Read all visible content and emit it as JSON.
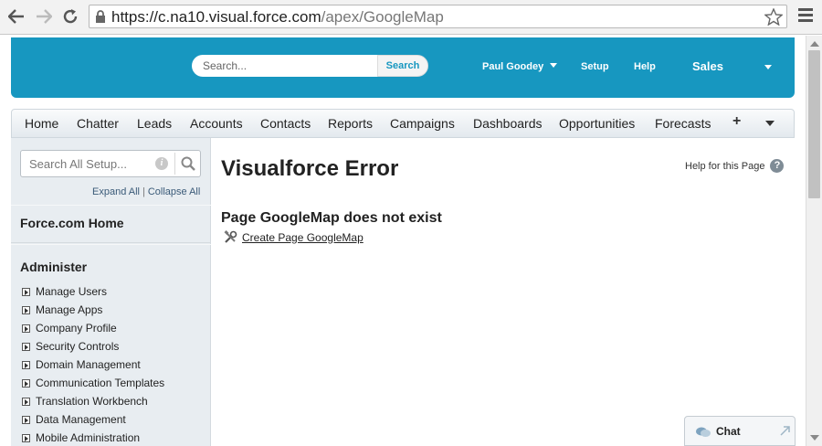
{
  "browser": {
    "url_host": "https://c.na10.visual.force.com",
    "url_path": "/apex/GoogleMap"
  },
  "header": {
    "search_placeholder": "Search...",
    "search_button": "Search",
    "user_name": "Paul Goodey",
    "setup": "Setup",
    "help": "Help",
    "app_name": "Sales",
    "colors": {
      "header_bg": "#1797c0"
    }
  },
  "tabs": [
    "Home",
    "Chatter",
    "Leads",
    "Accounts",
    "Contacts",
    "Reports",
    "Campaigns",
    "Dashboards",
    "Opportunities",
    "Forecasts"
  ],
  "tab_plus": "+",
  "sidebar": {
    "search_placeholder": "Search All Setup...",
    "expand_all": "Expand All",
    "collapse_all": "Collapse All",
    "home_link": "Force.com Home",
    "section_title": "Administer",
    "items": [
      "Manage Users",
      "Manage Apps",
      "Company Profile",
      "Security Controls",
      "Domain Management",
      "Communication Templates",
      "Translation Workbench",
      "Data Management",
      "Mobile Administration"
    ]
  },
  "main": {
    "heading": "Visualforce Error",
    "help_link": "Help for this Page",
    "error_title": "Page GoogleMap does not exist",
    "create_link": "Create Page GoogleMap"
  },
  "chat": {
    "label": "Chat"
  }
}
